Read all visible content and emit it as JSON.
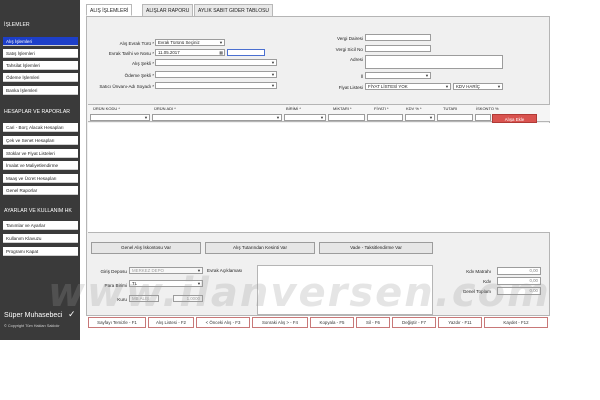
{
  "sidebar": {
    "sections": [
      {
        "title": "İŞLEMLER"
      },
      {
        "title": "HESAPLAR VE RAPORLAR"
      },
      {
        "title": "AYARLAR VE KULLANIM HK"
      }
    ],
    "islemler_items": [
      {
        "label": "Alış İşlemleri"
      },
      {
        "label": "Satış İşlemleri"
      },
      {
        "label": "Tahsilat İşlemleri"
      },
      {
        "label": "Ödeme İşlemleri"
      },
      {
        "label": "Banka İşlemleri"
      }
    ],
    "rapor_items": [
      {
        "label": "Cari - Borç Alacak Hesapları"
      },
      {
        "label": "Çek ve Senet Hesapları"
      },
      {
        "label": "Stoklar ve Fiyat Listeleri"
      },
      {
        "label": "İmalat ve Maliyetlendirme"
      },
      {
        "label": "Maaş ve Ücret Hesapları"
      },
      {
        "label": "Genel Raporlar"
      }
    ],
    "ayar_items": [
      {
        "label": "Tanımlar ve Ayarlar"
      },
      {
        "label": "Kullanım Klavuzu"
      },
      {
        "label": "Programı Kapat"
      }
    ],
    "footer_title": "Süper Muhasebeci",
    "footer_check": "✓",
    "footer_copy": "© Copyright Tüm Hakları Saklıdır"
  },
  "tabs": [
    {
      "label": "ALIŞ İŞLEMLERİ"
    },
    {
      "label": "ALIŞLAR RAPORU"
    },
    {
      "label": "AYLIK SABIT GIDER TABLOSU"
    }
  ],
  "form": {
    "evrak_turu_label": "Alış Evrak Türü *",
    "evrak_turu_value": "Evrak Türünü Seçiniz",
    "evrak_tarih_label": "Evrak Tarihi ve Nosu *",
    "evrak_tarih_value": "11.05.2017",
    "alis_sekli_label": "Alış Şekli *",
    "odeme_sekli_label": "Ödeme Şekli *",
    "satici_label": "Satıcı Ünvanı-Adı Soyadı *",
    "vergi_dairesi_label": "Vergi Dairesi",
    "vergi_sicil_label": "Vergi Sicil No",
    "adres_label": "Adresi",
    "il_label": "İl",
    "fiyat_listesi_label": "Fiyat Listesi",
    "fiyat_listesi_value": "FİYAT LİSTESİ YOK",
    "kdv_value": "KDV HARİÇ"
  },
  "grid": {
    "columns": [
      {
        "label": "ÜRÜN KODU *"
      },
      {
        "label": "ÜRÜN ADI *"
      },
      {
        "label": "BİRİMİ *"
      },
      {
        "label": "MİKTARI *"
      },
      {
        "label": "FİYATI *"
      },
      {
        "label": "KDV % *"
      },
      {
        "label": "TUTARI"
      },
      {
        "label": "İSKONTO %"
      }
    ],
    "add_button": "Alışa Ekle"
  },
  "mid_buttons": [
    {
      "label": "Genel Alış İskontosu Var"
    },
    {
      "label": "Alış Tutarından Kesinti Var"
    },
    {
      "label": "Vade - Taksitlendirme Var"
    }
  ],
  "lower": {
    "giris_deposu_label": "Giriş Deposu",
    "giris_deposu_value": "MERKEZ DEPO",
    "para_birimi_label": "Para Birimi",
    "para_birimi_value": "TL",
    "kuru_label": "Kuru",
    "kuru_value": "MB ALIŞ",
    "kuru_rate": "1,0000",
    "evrak_aciklamasi_label": "Evrak Açıklaması"
  },
  "totals": [
    {
      "label": "Kdv Matrahı",
      "value": "0,00"
    },
    {
      "label": "Kdv",
      "value": "0,00"
    },
    {
      "label": "Genel Toplam",
      "value": "0,00"
    }
  ],
  "function_buttons": [
    {
      "label": "Sayfayı Temizle - F1"
    },
    {
      "label": "Alış Listesi - F2"
    },
    {
      "label": "< Önceki Alış - F3"
    },
    {
      "label": "Sonraki Alış > - F4"
    },
    {
      "label": "Kopyala - F5"
    },
    {
      "label": "Sil - F6"
    },
    {
      "label": "Değiştir - F7"
    },
    {
      "label": "Yazdır - F11"
    },
    {
      "label": "Kaydet - F12"
    }
  ],
  "watermark": "www.ilanversen.com",
  "colors": {
    "sidebar_bg": "#3a3a3a",
    "active_item": "#1d3fc9",
    "add_button": "#d9534f",
    "panel_bg": "#f0f0f0"
  }
}
